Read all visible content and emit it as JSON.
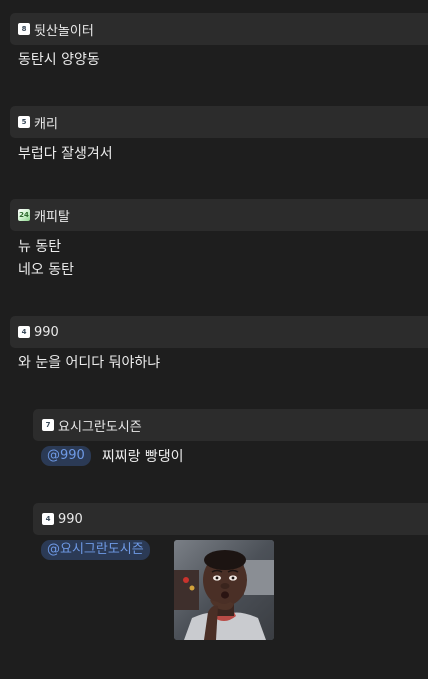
{
  "posts": [
    {
      "author": "뒷산놀이터",
      "badge": "8",
      "lines": [
        "동탄시 양양동"
      ]
    },
    {
      "author": "캐리",
      "badge": "5",
      "lines": [
        "부럽다 잘생겨서"
      ]
    },
    {
      "author": "캐피탈",
      "badge": "24",
      "lines": [
        "뉴 동탄",
        "네오 동탄"
      ]
    },
    {
      "author": "990",
      "badge": "4",
      "lines": [
        "와 눈을 어디다 둬야하냐"
      ]
    }
  ],
  "replies": [
    {
      "author": "요시그란도시즌",
      "badge": "7",
      "mention": "@990",
      "text": "찌찌랑 빵댕이"
    },
    {
      "author": "990",
      "badge": "4",
      "mention": "@요시그란도시즌",
      "image": "surprised-man-photo"
    }
  ],
  "colors": {
    "background": "#1e1e1e",
    "header_bar": "#2c2c2c",
    "mention_bg": "#2b3a55",
    "mention_text": "#6f9ae6"
  }
}
